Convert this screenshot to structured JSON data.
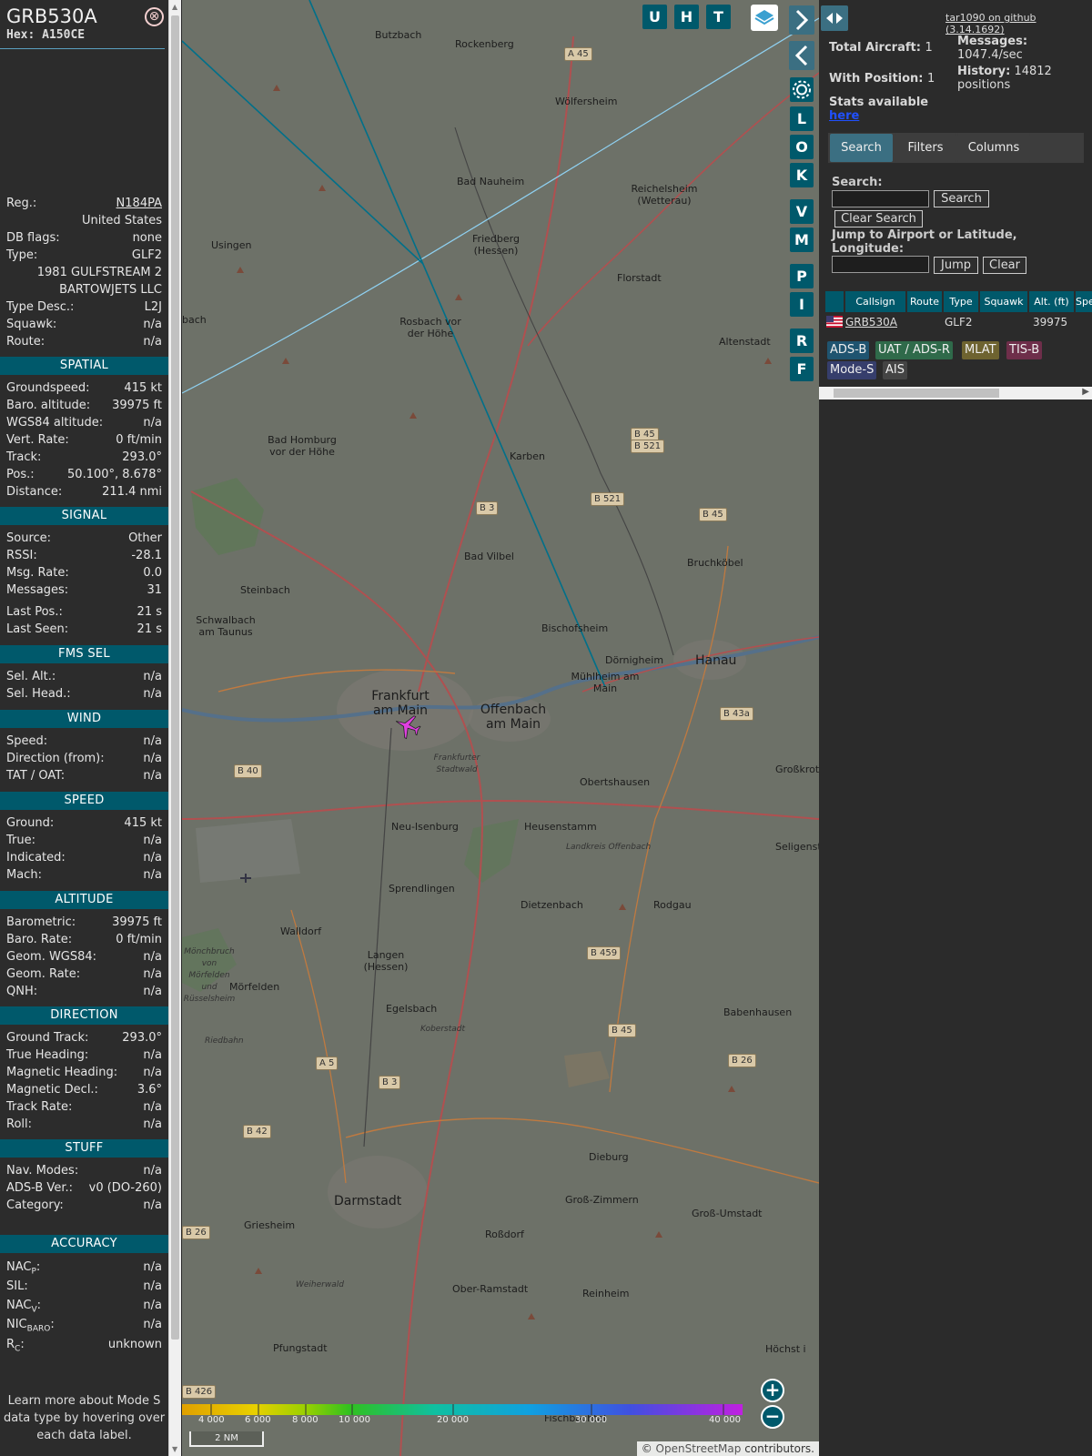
{
  "infoblock": {
    "callsign": "GRB530A",
    "hex_label": "Hex:",
    "hex": "A150CE",
    "close_glyph": "⊗",
    "rows_top": [
      {
        "k": "Reg.:",
        "v": "N184PA",
        "link": true
      },
      {
        "k": "",
        "v": "United States"
      },
      {
        "k": "DB flags:",
        "v": "none"
      },
      {
        "k": "Type:",
        "v": "GLF2"
      },
      {
        "k": "",
        "v": "1981 GULFSTREAM 2"
      },
      {
        "k": "",
        "v": "BARTOWJETS LLC"
      },
      {
        "k": "Type Desc.:",
        "v": "L2J"
      },
      {
        "k": "Squawk:",
        "v": "n/a"
      },
      {
        "k": "Route:",
        "v": "n/a"
      }
    ],
    "sections": [
      {
        "title": "SPATIAL",
        "rows": [
          {
            "k": "Groundspeed:",
            "v": "415 kt"
          },
          {
            "k": "Baro. altitude:",
            "v": "39975 ft"
          },
          {
            "k": "WGS84 altitude:",
            "v": "n/a"
          },
          {
            "k": "Vert. Rate:",
            "v": "0 ft/min"
          },
          {
            "k": "Track:",
            "v": "293.0°"
          },
          {
            "k": "Pos.:",
            "v": "50.100°, 8.678°"
          },
          {
            "k": "Distance:",
            "v": "211.4 nmi"
          }
        ]
      },
      {
        "title": "SIGNAL",
        "rows": [
          {
            "k": "Source:",
            "v": "Other"
          },
          {
            "k": "RSSI:",
            "v": "-28.1"
          },
          {
            "k": "Msg. Rate:",
            "v": "0.0"
          },
          {
            "k": "Messages:",
            "v": "31"
          },
          {
            "k": "Last Pos.:",
            "v": "21 s"
          },
          {
            "k": "Last Seen:",
            "v": "21 s"
          }
        ]
      },
      {
        "title": "FMS SEL",
        "rows": [
          {
            "k": "Sel. Alt.:",
            "v": "n/a"
          },
          {
            "k": "Sel. Head.:",
            "v": "n/a"
          }
        ]
      },
      {
        "title": "WIND",
        "rows": [
          {
            "k": "Speed:",
            "v": "n/a"
          },
          {
            "k": "Direction (from):",
            "v": "n/a"
          },
          {
            "k": "TAT / OAT:",
            "v": "n/a"
          }
        ]
      },
      {
        "title": "SPEED",
        "rows": [
          {
            "k": "Ground:",
            "v": "415 kt"
          },
          {
            "k": "True:",
            "v": "n/a"
          },
          {
            "k": "Indicated:",
            "v": "n/a"
          },
          {
            "k": "Mach:",
            "v": "n/a"
          }
        ]
      },
      {
        "title": "ALTITUDE",
        "rows": [
          {
            "k": "Barometric:",
            "v": "39975 ft"
          },
          {
            "k": "Baro. Rate:",
            "v": "0 ft/min"
          },
          {
            "k": "Geom. WGS84:",
            "v": "n/a"
          },
          {
            "k": "Geom. Rate:",
            "v": "n/a"
          },
          {
            "k": "QNH:",
            "v": "n/a"
          }
        ]
      },
      {
        "title": "DIRECTION",
        "rows": [
          {
            "k": "Ground Track:",
            "v": "293.0°"
          },
          {
            "k": "True Heading:",
            "v": "n/a"
          },
          {
            "k": "Magnetic Heading:",
            "v": "n/a"
          },
          {
            "k": "Magnetic Decl.:",
            "v": "3.6°"
          },
          {
            "k": "Track Rate:",
            "v": "n/a"
          },
          {
            "k": "Roll:",
            "v": "n/a"
          }
        ]
      },
      {
        "title": "STUFF",
        "rows": [
          {
            "k": "Nav. Modes:",
            "v": "n/a"
          },
          {
            "k": "ADS-B Ver.:",
            "v": "v0 (DO-260)"
          },
          {
            "k": "Category:",
            "v": "n/a"
          }
        ]
      },
      {
        "title": "ACCURACY",
        "rows": [
          {
            "k": "NAC",
            "sub": "P",
            "v": "n/a"
          },
          {
            "k": "SIL:",
            "v": "n/a"
          },
          {
            "k": "NAC",
            "sub": "V",
            "v": "n/a"
          },
          {
            "k": "NIC",
            "sub": "BARO",
            "v": "n/a"
          },
          {
            "k": "R",
            "sub": "C",
            "v": "unknown"
          }
        ]
      }
    ],
    "note": "Learn more about Mode S data type by hovering over each data label."
  },
  "map": {
    "top_buttons": [
      "U",
      "H",
      "T"
    ],
    "side_buttons": [
      "L",
      "O",
      "K",
      "V",
      "M",
      "P",
      "I",
      "R",
      "F"
    ],
    "places": [
      {
        "n": "Butzbach"
      },
      {
        "n": "Rockenberg"
      },
      {
        "n": "Wölfersheim"
      },
      {
        "n": "Bad Nauheim"
      },
      {
        "n": "Reichelsheim (Wetterau)"
      },
      {
        "n": "Usingen"
      },
      {
        "n": "Friedberg (Hessen)"
      },
      {
        "n": "Florstadt"
      },
      {
        "n": "Rosbach vor der Höhe"
      },
      {
        "n": "Altenstadt"
      },
      {
        "n": "Bad Homburg vor der Höhe"
      },
      {
        "n": "Karben"
      },
      {
        "n": "Bad Vilbel"
      },
      {
        "n": "Bruchköbel"
      },
      {
        "n": "Steinbach"
      },
      {
        "n": "Schwalbach am Taunus"
      },
      {
        "n": "Bischofsheim"
      },
      {
        "n": "Dörnigheim"
      },
      {
        "n": "Hanau"
      },
      {
        "n": "Mühlheim am Main"
      },
      {
        "n": "Frankfurt am Main"
      },
      {
        "n": "Offenbach am Main"
      },
      {
        "n": "Frankfurter Stadtwald"
      },
      {
        "n": "Obertshausen"
      },
      {
        "n": "Großkrotz"
      },
      {
        "n": "Neu-Isenburg"
      },
      {
        "n": "Heusenstamm"
      },
      {
        "n": "Seligenst"
      },
      {
        "n": "Landkreis Offenbach"
      },
      {
        "n": "Sprendlingen"
      },
      {
        "n": "Dietzenbach"
      },
      {
        "n": "Rodgau"
      },
      {
        "n": "Walldorf"
      },
      {
        "n": "Langen (Hessen)"
      },
      {
        "n": "Mörfelden"
      },
      {
        "n": "Egelsbach"
      },
      {
        "n": "Babenhausen"
      },
      {
        "n": "Koberstadt"
      },
      {
        "n": "Dieburg"
      },
      {
        "n": "Darmstadt"
      },
      {
        "n": "Griesheim"
      },
      {
        "n": "Groß-Zimmern"
      },
      {
        "n": "Groß-Umstadt"
      },
      {
        "n": "Roßdorf"
      },
      {
        "n": "Ober-Ramstadt"
      },
      {
        "n": "Reinheim"
      },
      {
        "n": "Pfungstadt"
      },
      {
        "n": "Höchst i"
      },
      {
        "n": "Fischbachtal"
      },
      {
        "n": "Weiherwald"
      },
      {
        "n": "bach"
      },
      {
        "n": "Mönchbruch von Mörfelden und Rüsselsheim"
      },
      {
        "n": "Riedbahn"
      }
    ],
    "roads": [
      "A 45",
      "B 45",
      "B 521",
      "B 3",
      "B 521",
      "B 45",
      "B 43a",
      "B 40",
      "B 459",
      "B 45",
      "A 5",
      "B 3",
      "B 26",
      "B 42",
      "B 26",
      "B 426"
    ],
    "altitude_scale": [
      "4 000",
      "6 000",
      "8 000",
      "10 000",
      "20 000",
      "30 000",
      "40 000"
    ],
    "scale_distance": "2 NM",
    "zoom_in": "+",
    "zoom_out": "−",
    "attribution_prefix": "© ",
    "attribution_link": "OpenStreetMap",
    "attribution_suffix": " contributors.",
    "colors": {
      "map_bg": "#6d7168",
      "button": "#00596b",
      "aircraft": "#e040e0",
      "trail": "#00708a",
      "range": "#8fd0f0"
    }
  },
  "panel": {
    "github": "tar1090 on github (3.14.1692)",
    "total_label": "Total Aircraft:",
    "total": "1",
    "pos_label": "With Position:",
    "pos": "1",
    "msg_label": "Messages:",
    "msg": "1047.4/sec",
    "hist_label": "History:",
    "hist": "14812",
    "hist_unit": "positions",
    "stats_label": "Stats available",
    "stats_link": "here",
    "tabs": [
      "Search",
      "Filters",
      "Columns"
    ],
    "search_label": "Search:",
    "search_button": "Search",
    "clear_search": "Clear Search",
    "jump_label": "Jump to Airport or Latitude, Longitude:",
    "jump_button": "Jump",
    "clear_button": "Clear",
    "table_headers": [
      "",
      "Callsign",
      "Route",
      "Type",
      "Squawk",
      "Alt. (ft)",
      "Spe"
    ],
    "table_rows": [
      {
        "flag": "US",
        "callsign": "GRB530A",
        "route": "",
        "type": "GLF2",
        "squawk": "",
        "alt": "39975"
      }
    ],
    "badges": [
      {
        "t": "ADS-B",
        "c": "#1f5470"
      },
      {
        "t": "UAT / ADS-R",
        "c": "#2f6a4a"
      },
      {
        "t": "MLAT",
        "c": "#6e6330"
      },
      {
        "t": "TIS-B",
        "c": "#6e2e4a"
      },
      {
        "t": "Mode-S",
        "c": "#363e6c"
      },
      {
        "t": "AIS",
        "c": "#444444"
      }
    ]
  }
}
